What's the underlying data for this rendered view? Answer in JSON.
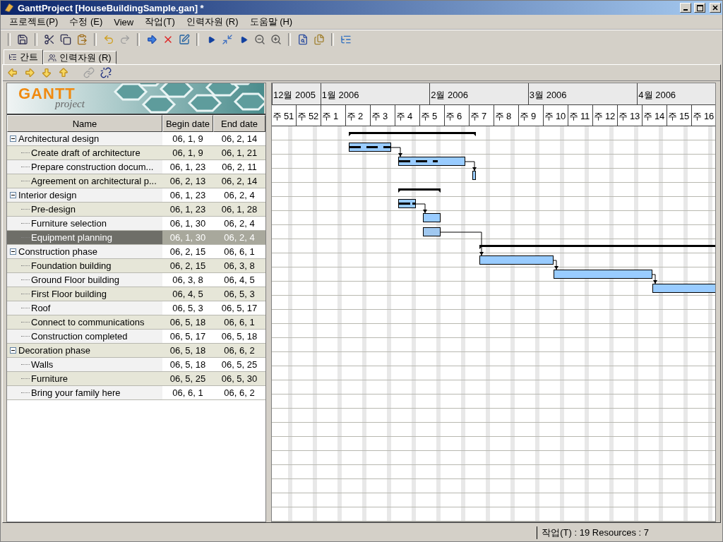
{
  "window": {
    "title": "GanttProject [HouseBuildingSample.gan] *"
  },
  "menu": [
    "프로젝트(P)",
    "수정 (E)",
    "View",
    "작업(T)",
    "인력자원 (R)",
    "도움말 (H)"
  ],
  "tabs": [
    {
      "label": "간트",
      "selected": true
    },
    {
      "label": "인력자원 (R)",
      "selected": false
    }
  ],
  "logo": {
    "wordmark": "GANTT",
    "subtitle": "project"
  },
  "table": {
    "columns": [
      "Name",
      "Begin date",
      "End date"
    ],
    "rows": [
      {
        "name": "Architectural design",
        "begin": "06, 1, 9",
        "end": "06, 2, 14",
        "selected": false,
        "expanded": true,
        "children": [
          {
            "name": "Create draft of architecture",
            "begin": "06, 1, 9",
            "end": "06, 1, 21",
            "selected": false,
            "level": 1
          },
          {
            "name": "Prepare construction docum...",
            "begin": "06, 1, 23",
            "end": "06, 2, 11",
            "selected": false,
            "level": 0.6
          },
          {
            "name": "Agreement on architectural p...",
            "begin": "06, 2, 13",
            "end": "06, 2, 14",
            "selected": false
          }
        ]
      },
      {
        "name": "Interior design",
        "begin": "06, 1, 23",
        "end": "06, 2, 4",
        "selected": false,
        "expanded": true,
        "children": [
          {
            "name": "Pre-design",
            "begin": "06, 1, 23",
            "end": "06, 1, 28",
            "selected": false,
            "level": 1
          },
          {
            "name": "Furniture selection",
            "begin": "06, 1, 30",
            "end": "06, 2, 4",
            "selected": false
          },
          {
            "name": "Equipment planning",
            "begin": "06, 1, 30",
            "end": "06, 2, 4",
            "selected": true
          }
        ]
      },
      {
        "name": "Construction phase",
        "begin": "06, 2, 15",
        "end": "06, 6, 1",
        "selected": false,
        "expanded": true,
        "children": [
          {
            "name": "Foundation building",
            "begin": "06, 2, 15",
            "end": "06, 3, 8",
            "selected": false
          },
          {
            "name": "Ground Floor building",
            "begin": "06, 3, 8",
            "end": "06, 4, 5",
            "selected": false
          },
          {
            "name": "First Floor building",
            "begin": "06, 4, 5",
            "end": "06, 5, 3",
            "selected": false
          },
          {
            "name": "Roof",
            "begin": "06, 5, 3",
            "end": "06, 5, 17",
            "selected": false
          },
          {
            "name": "Connect to communications",
            "begin": "06, 5, 18",
            "end": "06, 6, 1",
            "selected": false
          },
          {
            "name": "Construction completed",
            "begin": "06, 5, 17",
            "end": "06, 5, 18",
            "selected": false
          }
        ]
      },
      {
        "name": "Decoration phase",
        "begin": "06, 5, 18",
        "end": "06, 6, 2",
        "selected": false,
        "expanded": true,
        "children": [
          {
            "name": "Walls",
            "begin": "06, 5, 18",
            "end": "06, 5, 25",
            "selected": false
          },
          {
            "name": "Furniture",
            "begin": "06, 5, 25",
            "end": "06, 5, 30",
            "selected": false
          },
          {
            "name": "Bring your family here",
            "begin": "06, 6, 1",
            "end": "06, 6, 2",
            "selected": false
          }
        ]
      }
    ]
  },
  "timeline": {
    "months": [
      "12월 2005",
      "1월 2006",
      "2월 2006",
      "3월 2006",
      "4월 2006"
    ],
    "weeks": [
      "주 51",
      "주 52",
      "주 1",
      "주 2",
      "주 3",
      "주 4",
      "주 5",
      "주 6",
      "주 7",
      "주 8",
      "주 9",
      "주 10",
      "주 11",
      "주 12",
      "주 13",
      "주 14",
      "주 15",
      "주 16"
    ]
  },
  "status_bar": {
    "right": "작업(T) : 19  Resources : 7"
  }
}
